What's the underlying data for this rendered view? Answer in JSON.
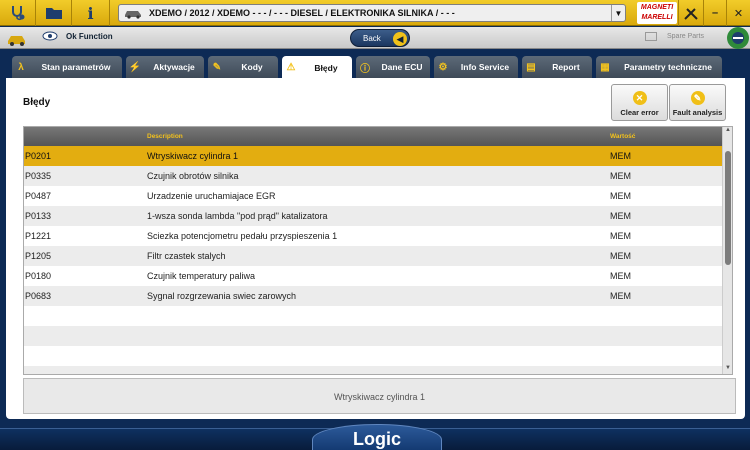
{
  "topbar": {
    "vehicle_text": "XDEMO / 2012 / XDEMO - - - / - - - DIESEL / ELEKTRONIKA SILNIKA / - - -",
    "logo_line1": "MAGNETI",
    "logo_line2": "MARELLI",
    "minimize_label": "–",
    "close_label": "✕"
  },
  "secondbar": {
    "ok_function_label": "Ok Function",
    "back_label": "Back",
    "spare_parts_label": "Spare Parts"
  },
  "tabs": [
    {
      "label": "Stan parametrów",
      "icon": "lambda-icon"
    },
    {
      "label": "Aktywacje",
      "icon": "lightning-icon"
    },
    {
      "label": "Kody",
      "icon": "wrench-icon"
    },
    {
      "label": "Błędy",
      "icon": "warning-icon"
    },
    {
      "label": "Dane ECU",
      "icon": "ecu-info-icon"
    },
    {
      "label": "Info Service",
      "icon": "gears-icon"
    },
    {
      "label": "Report",
      "icon": "printer-icon"
    },
    {
      "label": "Parametry techniczne",
      "icon": "book-icon"
    }
  ],
  "panel": {
    "title": "Błędy",
    "clear_error_label": "Clear error",
    "fault_analysis_label": "Fault analysis",
    "columns": [
      "",
      "Description",
      "Wartość"
    ],
    "rows": [
      {
        "code": "P0201",
        "description": "Wtryskiwacz cylindra 1",
        "value": "MEM"
      },
      {
        "code": "P0335",
        "description": "Czujnik obrotów silnika",
        "value": "MEM"
      },
      {
        "code": "P0487",
        "description": "Urzadzenie uruchamiajace EGR",
        "value": "MEM"
      },
      {
        "code": "P0133",
        "description": "1-wsza sonda lambda \"pod prąd\" katalizatora",
        "value": "MEM"
      },
      {
        "code": "P1221",
        "description": "Sciezka potencjometru pedału przyspieszenia 1",
        "value": "MEM"
      },
      {
        "code": "P1205",
        "description": "Filtr czastek stalych",
        "value": "MEM"
      },
      {
        "code": "P0180",
        "description": "Czujnik temperatury paliwa",
        "value": "MEM"
      },
      {
        "code": "P0683",
        "description": "Sygnal rozgrzewania swiec zarowych",
        "value": "MEM"
      }
    ],
    "selected_detail": "Wtryskiwacz cylindra 1"
  },
  "brand": "Logic",
  "colors": {
    "accent": "#e3ad10",
    "header": "#555555",
    "nav": "#0d2a55"
  }
}
